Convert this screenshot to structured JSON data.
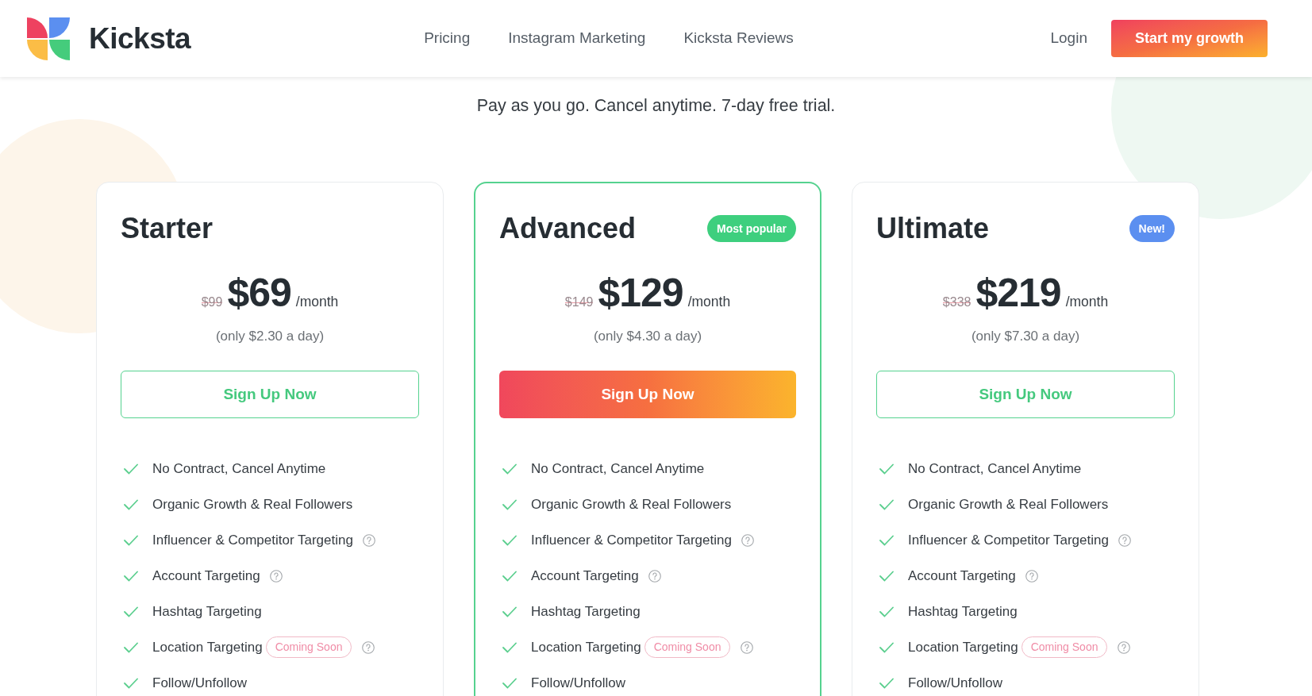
{
  "header": {
    "logo": {
      "text": "Kicksta"
    },
    "nav": [
      {
        "label": "Pricing"
      },
      {
        "label": "Instagram Marketing"
      },
      {
        "label": "Kicksta Reviews"
      }
    ],
    "login": "Login",
    "cta": "Start my growth"
  },
  "tagline": "Pay as you go. Cancel anytime. 7-day free trial.",
  "plans": [
    {
      "name": "Starter",
      "featured": false,
      "old_price": "$99",
      "price": "$69",
      "period": "/month",
      "per_day": "(only $2.30 a day)",
      "button": "Sign Up Now",
      "features": [
        {
          "text": "No Contract, Cancel Anytime",
          "included": true,
          "help": false
        },
        {
          "text": "Organic Growth & Real Followers",
          "included": true,
          "help": false
        },
        {
          "text": "Influencer & Competitor Targeting",
          "included": true,
          "help": true
        },
        {
          "text": "Account Targeting",
          "included": true,
          "help": true
        },
        {
          "text": "Hashtag Targeting",
          "included": true,
          "help": false
        },
        {
          "text": "Location Targeting",
          "included": true,
          "tag": "Coming Soon",
          "help": true
        },
        {
          "text": "Follow/Unfollow",
          "included": true,
          "help": false
        }
      ]
    },
    {
      "name": "Advanced",
      "featured": true,
      "badge": {
        "text": "Most popular",
        "color": "#3ecf7e"
      },
      "old_price": "$149",
      "price": "$129",
      "period": "/month",
      "per_day": "(only $4.30 a day)",
      "button": "Sign Up Now",
      "features": [
        {
          "text": "No Contract, Cancel Anytime",
          "included": true,
          "help": false
        },
        {
          "text": "Organic Growth & Real Followers",
          "included": true,
          "help": false
        },
        {
          "text": "Influencer & Competitor Targeting",
          "included": true,
          "help": true
        },
        {
          "text": "Account Targeting",
          "included": true,
          "help": true
        },
        {
          "text": "Hashtag Targeting",
          "included": true,
          "help": false
        },
        {
          "text": "Location Targeting",
          "included": true,
          "tag": "Coming Soon",
          "help": true
        },
        {
          "text": "Follow/Unfollow",
          "included": true,
          "help": false
        }
      ]
    },
    {
      "name": "Ultimate",
      "featured": false,
      "badge": {
        "text": "New!",
        "color": "#5b8ff0"
      },
      "old_price": "$338",
      "price": "$219",
      "period": "/month",
      "per_day": "(only $7.30 a day)",
      "button": "Sign Up Now",
      "features": [
        {
          "text": "No Contract, Cancel Anytime",
          "included": true,
          "help": false
        },
        {
          "text": "Organic Growth & Real Followers",
          "included": true,
          "help": false
        },
        {
          "text": "Influencer & Competitor Targeting",
          "included": true,
          "help": true
        },
        {
          "text": "Account Targeting",
          "included": true,
          "help": true
        },
        {
          "text": "Hashtag Targeting",
          "included": true,
          "help": false
        },
        {
          "text": "Location Targeting",
          "included": true,
          "tag": "Coming Soon",
          "help": true
        },
        {
          "text": "Follow/Unfollow",
          "included": true,
          "help": false
        }
      ]
    }
  ]
}
